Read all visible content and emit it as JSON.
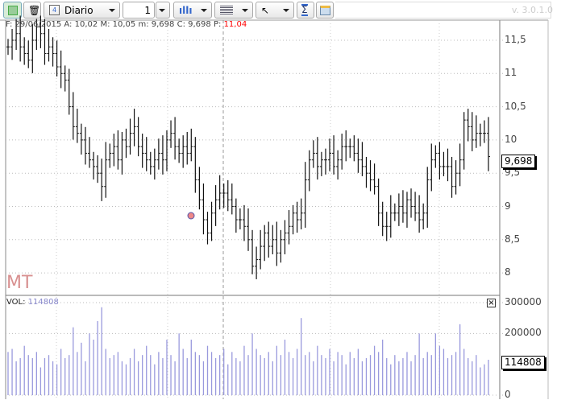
{
  "toolbar": {
    "period": "Diario",
    "quantity": "1",
    "version": "v. 3.0.1.0",
    "calendar_day": "4"
  },
  "info": {
    "f_label": "F:",
    "date": "29/06/2015",
    "a_label": "A:",
    "open": "10,02",
    "m_label": "M:",
    "high": "10,05",
    "lo_label": "m:",
    "low": "9,698",
    "c_label": "C:",
    "close": "9,698",
    "p_label": "P:",
    "cursor_price": "11,04"
  },
  "watermark": "MT",
  "volume": {
    "label": "VOL:",
    "value": "114808"
  },
  "price_axis": {
    "labels": [
      "11,5",
      "11",
      "10,5",
      "10",
      "9,5",
      "9",
      "8,5",
      "8"
    ],
    "current": "9,698"
  },
  "volume_axis": {
    "labels": [
      "300000",
      "200000",
      "0"
    ],
    "current": "114808"
  },
  "colors": {
    "bars": "#111111",
    "volume": "#9999dd",
    "price_tag_border": "#000000",
    "cursor_price": "#ff0000"
  },
  "chart_data": {
    "type": "ohlc",
    "ylim": [
      7.7,
      11.8
    ],
    "vol_ylim": [
      0,
      300000
    ],
    "close": [
      11.4,
      11.5,
      11.6,
      11.4,
      11.3,
      11.2,
      11.5,
      11.7,
      11.6,
      11.3,
      11.4,
      11.3,
      11.1,
      11.0,
      10.9,
      10.5,
      10.2,
      10.1,
      10.0,
      9.8,
      9.7,
      9.6,
      9.5,
      9.3,
      9.7,
      9.8,
      9.9,
      9.7,
      10.0,
      9.9,
      10.1,
      10.2,
      9.9,
      9.8,
      9.7,
      9.6,
      9.7,
      9.8,
      9.7,
      10.0,
      10.1,
      9.9,
      9.8,
      9.9,
      9.8,
      9.9,
      9.4,
      9.1,
      8.8,
      8.6,
      8.9,
      9.1,
      9.2,
      9.2,
      9.1,
      9.0,
      8.8,
      8.8,
      8.7,
      8.5,
      8.1,
      8.2,
      8.4,
      8.6,
      8.4,
      8.5,
      8.3,
      8.5,
      8.6,
      8.7,
      8.9,
      8.8,
      8.9,
      9.4,
      9.7,
      9.8,
      9.6,
      9.7,
      9.7,
      9.8,
      9.6,
      9.7,
      9.9,
      9.9,
      9.9,
      9.8,
      9.7,
      9.6,
      9.5,
      9.4,
      9.3,
      8.9,
      8.7,
      8.7,
      8.9,
      8.9,
      9.0,
      8.9,
      9.1,
      9.0,
      8.9,
      8.8,
      8.9,
      9.4,
      9.7,
      9.8,
      9.6,
      9.6,
      9.6,
      9.3,
      9.5,
      9.7,
      10.3,
      10.2,
      10.0,
      10.1,
      10.1,
      10.1,
      9.75
    ],
    "volume": [
      140000,
      150000,
      110000,
      120000,
      160000,
      130000,
      120000,
      140000,
      90000,
      120000,
      130000,
      110000,
      100000,
      150000,
      120000,
      130000,
      220000,
      140000,
      170000,
      110000,
      200000,
      180000,
      240000,
      285000,
      150000,
      120000,
      130000,
      140000,
      110000,
      100000,
      120000,
      150000,
      110000,
      130000,
      160000,
      130000,
      100000,
      140000,
      120000,
      180000,
      130000,
      110000,
      200000,
      150000,
      120000,
      180000,
      140000,
      130000,
      110000,
      160000,
      140000,
      120000,
      130000,
      150000,
      100000,
      140000,
      120000,
      110000,
      160000,
      130000,
      200000,
      150000,
      130000,
      120000,
      140000,
      110000,
      160000,
      130000,
      180000,
      140000,
      120000,
      150000,
      250000,
      130000,
      140000,
      110000,
      160000,
      130000,
      120000,
      150000,
      110000,
      140000,
      130000,
      100000,
      140000,
      120000,
      150000,
      110000,
      120000,
      130000,
      160000,
      140000,
      180000,
      120000,
      100000,
      130000,
      110000,
      120000,
      140000,
      110000,
      130000,
      200000,
      120000,
      140000,
      130000,
      200000,
      160000,
      150000,
      120000,
      130000,
      140000,
      230000,
      150000,
      120000,
      110000,
      130000,
      90000,
      100000,
      114808
    ]
  }
}
